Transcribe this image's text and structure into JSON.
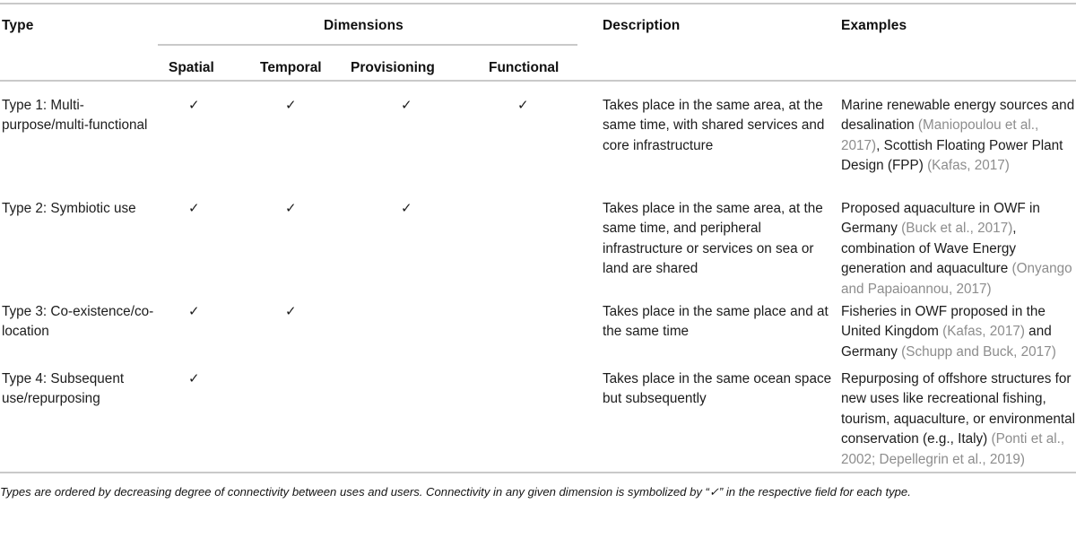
{
  "table": {
    "header": {
      "type_label": "Type",
      "dimensions_label": "Dimensions",
      "description_label": "Description",
      "examples_label": "Examples",
      "dimension_columns": [
        "Spatial",
        "Temporal",
        "Provisioning",
        "Functional"
      ]
    },
    "check_glyph": "✓",
    "rows": [
      {
        "type": "Type 1: Multi-purpose/multi-functional",
        "dimensions": {
          "Spatial": true,
          "Temporal": true,
          "Provisioning": true,
          "Functional": true
        },
        "description": "Takes place in the same area, at the same time, with shared services and core infrastructure",
        "examples_plain_1": "Marine renewable energy sources and desalination ",
        "examples_cite_1": "(Maniopoulou et al., 2017)",
        "examples_plain_2": ", Scottish Floating Power Plant Design (FPP) ",
        "examples_cite_2": "(Kafas, 2017)",
        "examples_plain_3": ""
      },
      {
        "type": "Type 2: Symbiotic use",
        "dimensions": {
          "Spatial": true,
          "Temporal": true,
          "Provisioning": true,
          "Functional": false
        },
        "description": "Takes place in the same area, at the same time, and peripheral infrastructure or services on sea or land are shared",
        "examples_plain_1": "Proposed aquaculture in OWF in Germany ",
        "examples_cite_1": "(Buck et al., 2017)",
        "examples_plain_2": ", combination of Wave Energy generation and aquaculture ",
        "examples_cite_2": "(Onyango and Papaioannou, 2017)",
        "examples_plain_3": ""
      },
      {
        "type": "Type 3: Co-existence/co-location",
        "dimensions": {
          "Spatial": true,
          "Temporal": true,
          "Provisioning": false,
          "Functional": false
        },
        "description": "Takes place in the same place and at the same time",
        "examples_plain_1": "Fisheries in OWF proposed in the United Kingdom ",
        "examples_cite_1": "(Kafas, 2017)",
        "examples_plain_2": " and Germany ",
        "examples_cite_2": "(Schupp and Buck, 2017)",
        "examples_plain_3": ""
      },
      {
        "type": "Type 4: Subsequent use/repurposing",
        "dimensions": {
          "Spatial": true,
          "Temporal": false,
          "Provisioning": false,
          "Functional": false
        },
        "description": "Takes place in the same ocean space but subsequently",
        "examples_plain_1": "Repurposing of offshore structures for new uses like recreational fishing, tourism, aquaculture, or environmental conservation (e.g., Italy) ",
        "examples_cite_1": "(Ponti et al., 2002; Depellegrin et al., 2019)",
        "examples_plain_2": "",
        "examples_cite_2": "",
        "examples_plain_3": ""
      }
    ],
    "footnote": "Types are ordered by decreasing degree of connectivity between uses and users. Connectivity in any given dimension is symbolized by “✓” in the respective field for each type."
  }
}
